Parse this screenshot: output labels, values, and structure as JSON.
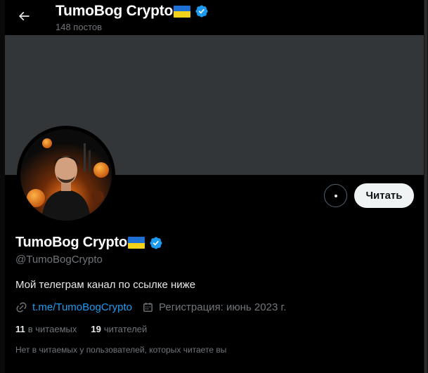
{
  "header": {
    "display_name": "TumoBog Crypto",
    "post_count": "148 постов"
  },
  "profile": {
    "display_name": "TumoBog Crypto",
    "handle": "@TumoBogCrypto",
    "bio": "Мой телеграм канал по ссылке ниже",
    "link": "t.me/TumoBogCrypto",
    "joined": "Регистрация: июнь 2023 г.",
    "following_count": "11",
    "following_label": "в читаемых",
    "followers_count": "19",
    "followers_label": "читателей",
    "mutuals_note": "Нет в читаемых у пользователей, которых читаете вы"
  },
  "actions": {
    "follow_label": "Читать",
    "more_icon": "more-horizontal-icon"
  },
  "colors": {
    "accent": "#1d9bf0",
    "banner": "#333639",
    "background": "#000000",
    "secondary_text": "#71767b"
  }
}
